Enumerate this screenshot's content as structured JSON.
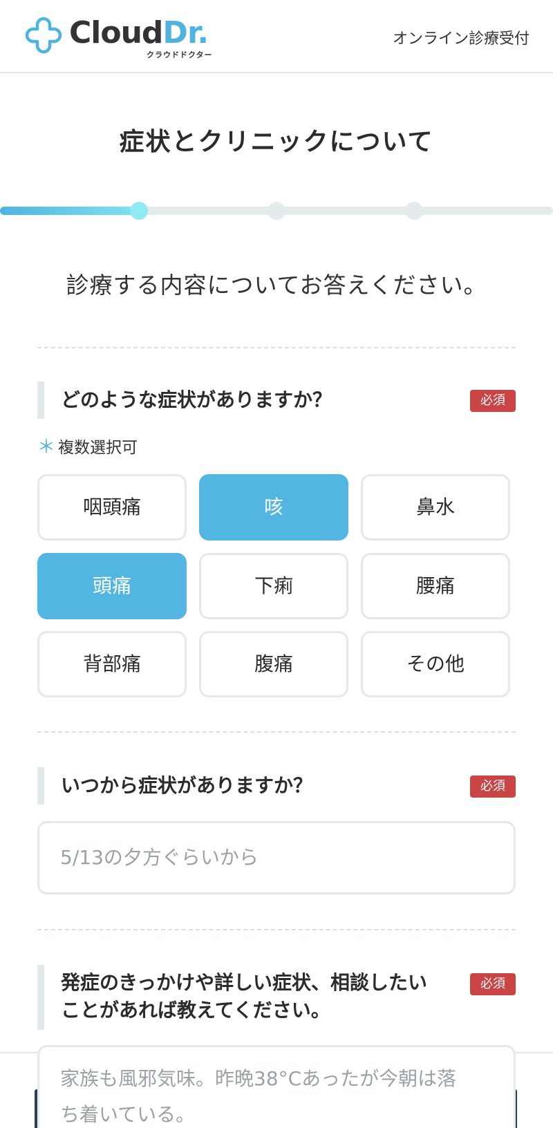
{
  "header": {
    "logo_main_a": "Cloud",
    "logo_main_b": "Dr.",
    "logo_sub": "クラウドドクター",
    "right_label": "オンライン診療受付"
  },
  "page": {
    "title": "症状とクリニックについて",
    "instruction": "診療する内容についてお答えください。"
  },
  "progress": {
    "current_step": 1,
    "total_steps": 4
  },
  "q1": {
    "label": "どのような症状がありますか？",
    "required": "必須",
    "note_star": "＊",
    "note": "複数選択可",
    "options": [
      {
        "label": "咽頭痛",
        "selected": false
      },
      {
        "label": "咳",
        "selected": true
      },
      {
        "label": "鼻水",
        "selected": false
      },
      {
        "label": "頭痛",
        "selected": true
      },
      {
        "label": "下痢",
        "selected": false
      },
      {
        "label": "腰痛",
        "selected": false
      },
      {
        "label": "背部痛",
        "selected": false
      },
      {
        "label": "腹痛",
        "selected": false
      },
      {
        "label": "その他",
        "selected": false
      }
    ]
  },
  "q2": {
    "label": "いつから症状がありますか？",
    "required": "必須",
    "value": "5/13の夕方ぐらいから"
  },
  "q3": {
    "label_line1": "発症のきっかけや詳しい症状、相談したい",
    "label_line2": "ことがあれば教えてください。",
    "required": "必須",
    "value_line1": "家族も風邪気味。昨晩38°Cあったが今朝は落",
    "value_line2": "ち着いている。"
  },
  "colors": {
    "accent": "#52b5e2",
    "required_badge": "#c94444",
    "progress_active": "#8feaf2"
  },
  "icons": {
    "logo_mark": "cloud-cross-logo-icon"
  }
}
